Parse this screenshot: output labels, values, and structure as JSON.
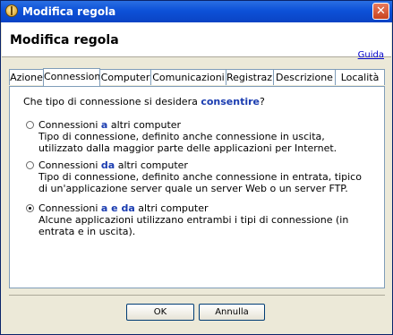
{
  "window": {
    "title": "Modifica regola",
    "close_glyph": "✕",
    "icon": "firewall-app-icon"
  },
  "header": {
    "title": "Modifica regola",
    "help_link": "Guida"
  },
  "tabs": [
    {
      "label": "Azione",
      "active": false
    },
    {
      "label": "Connessioni",
      "active": true
    },
    {
      "label": "Computer",
      "active": false
    },
    {
      "label": "Comunicazioni",
      "active": false
    },
    {
      "label": "Registrazi",
      "active": false
    },
    {
      "label": "Descrizione",
      "active": false
    },
    {
      "label": "Località",
      "active": false
    }
  ],
  "panel": {
    "question_pre": "Che tipo di connessione si desidera ",
    "question_em": "consentire",
    "question_post": "?",
    "options": [
      {
        "label_pre": "Connessioni ",
        "label_em": "a",
        "label_post": " altri computer",
        "description": "Tipo di connessione, definito anche connessione in uscita, utilizzato dalla maggior parte delle applicazioni per Internet.",
        "selected": false
      },
      {
        "label_pre": "Connessioni ",
        "label_em": "da",
        "label_post": " altri computer",
        "description": "Tipo di connessione, definito anche connessione in entrata, tipico di un'applicazione server quale un server Web o un server FTP.",
        "selected": false
      },
      {
        "label_pre": "Connessioni ",
        "label_em": "a e da",
        "label_post": " altri computer",
        "description": "Alcune applicazioni utilizzano entrambi i tipi di connessione (in entrata e in uscita).",
        "selected": true
      }
    ]
  },
  "buttons": {
    "ok": "OK",
    "cancel": "Annulla"
  }
}
